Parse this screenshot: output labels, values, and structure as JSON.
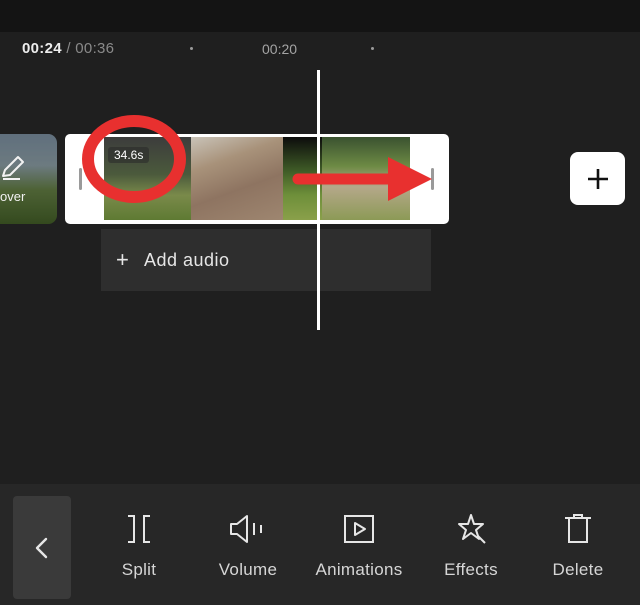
{
  "timeline": {
    "current_time": "00:24",
    "total_time": "/ 00:36",
    "ruler_label": "00:20"
  },
  "cover": {
    "label": "over",
    "icon": "pencil-icon"
  },
  "clip": {
    "duration": "34.6s"
  },
  "audio": {
    "plus": "+",
    "label": "Add audio"
  },
  "add_clip_icon": "plus-icon",
  "annotation": {
    "circle_color": "#e8302f",
    "arrow_color": "#e8302f"
  },
  "toolbar": {
    "back_icon": "chevron-left-icon",
    "tools": [
      {
        "label": "Split",
        "icon": "split-icon"
      },
      {
        "label": "Volume",
        "icon": "volume-icon"
      },
      {
        "label": "Animations",
        "icon": "animations-icon"
      },
      {
        "label": "Effects",
        "icon": "effects-icon"
      },
      {
        "label": "Delete",
        "icon": "trash-icon"
      }
    ]
  }
}
